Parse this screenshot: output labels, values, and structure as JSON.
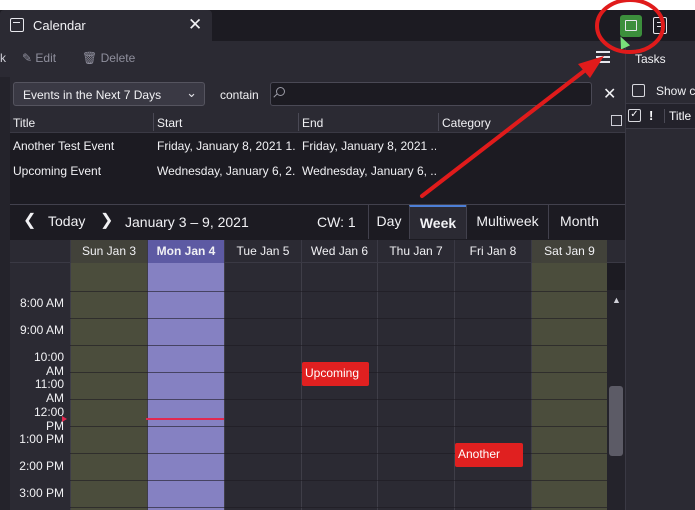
{
  "tab": {
    "label": "Calendar",
    "close": "✕"
  },
  "toolbar": {
    "new_suffix": "k",
    "edit_label": "Edit",
    "delete_label": "Delete"
  },
  "sidebar": {
    "tasks_label": "Tasks",
    "show_completed_label": "Show c",
    "col_title": "Title",
    "col_priority": "!"
  },
  "filter": {
    "selected": "Events in the Next 7 Days",
    "contain_label": "contain",
    "search_placeholder": "",
    "clear": "✕"
  },
  "list": {
    "columns": [
      "Title",
      "Start",
      "End",
      "Category"
    ],
    "rows": [
      {
        "title": "Another Test Event",
        "start": "Friday, January 8, 2021 1...",
        "end": "Friday, January 8, 2021 ...",
        "category": ""
      },
      {
        "title": "Upcoming Event",
        "start": "Wednesday, January 6, 2...",
        "end": "Wednesday, January 6, ...",
        "category": ""
      }
    ]
  },
  "nav": {
    "prev": "❮",
    "today": "Today",
    "next": "❯",
    "range": "January 3 – 9, 2021",
    "cw": "CW: 1"
  },
  "views": {
    "day": "Day",
    "week": "Week",
    "multiweek": "Multiweek",
    "month": "Month"
  },
  "days": [
    "Sun Jan 3",
    "Mon Jan 4",
    "Tue Jan 5",
    "Wed Jan 6",
    "Thu Jan 7",
    "Fri Jan 8",
    "Sat Jan 9"
  ],
  "times": [
    "8:00 AM",
    "9:00 AM",
    "10:00 AM",
    "11:00 AM",
    "12:00 PM",
    "1:00 PM",
    "2:00 PM",
    "3:00 PM"
  ],
  "events": [
    {
      "label": "Upcoming"
    },
    {
      "label": "Another"
    }
  ],
  "colors": {
    "today_column": "#8581c2",
    "weekend_column": "#4b4d3c",
    "event": "#e02020",
    "annotation": "#e01b1b",
    "accent": "#4d7fd6"
  }
}
